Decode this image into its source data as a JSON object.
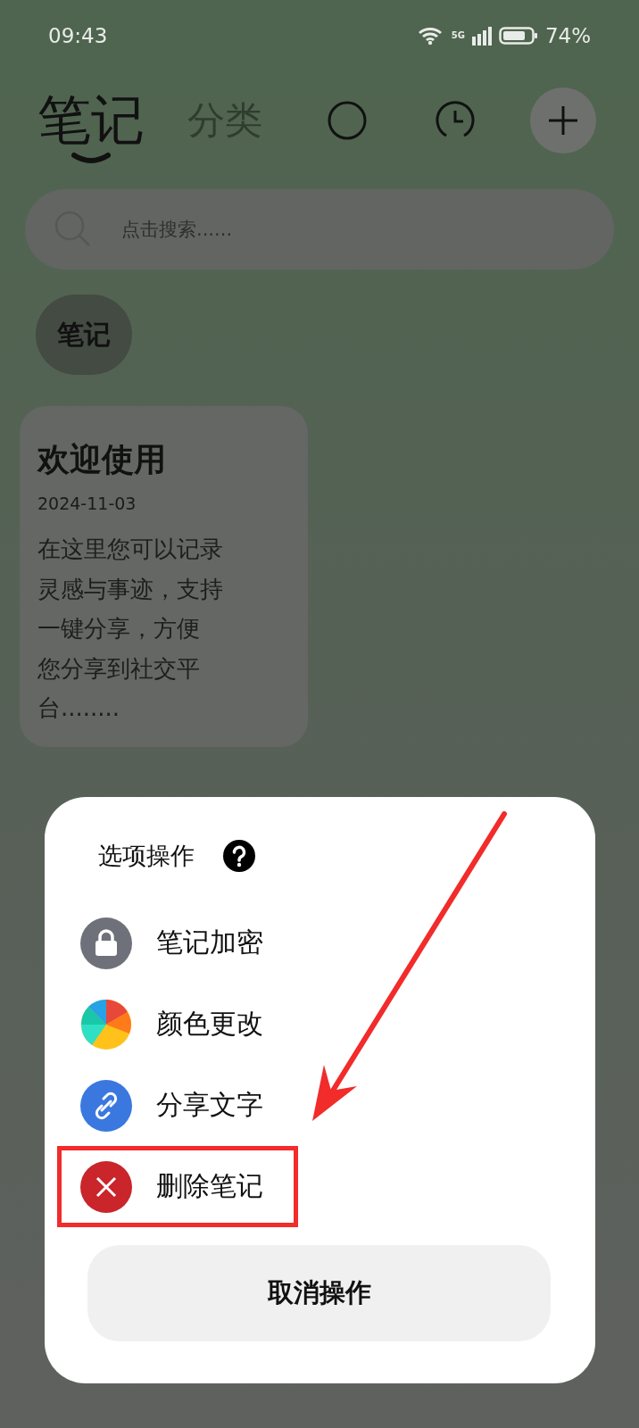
{
  "status_bar": {
    "time": "09:43",
    "network": "5G",
    "battery": "74%"
  },
  "tabs": [
    {
      "label": "笔记",
      "selected": true
    },
    {
      "label": "分类",
      "selected": false
    }
  ],
  "toolbar": [
    {
      "kind": "circle"
    },
    {
      "kind": "clock"
    },
    {
      "kind": "add"
    }
  ],
  "search": {
    "placeholder": "点击搜索......"
  },
  "filters": [
    {
      "label": "笔记",
      "selected": true
    }
  ],
  "notes": [
    {
      "title": "欢迎使用",
      "date": "2024-11-03",
      "preview_lines": [
        "在这里您可以记录",
        "灵感与事迹，支持",
        "一键分享，方便",
        "您分享到社交平",
        "台........"
      ]
    }
  ],
  "dialog": {
    "title": "选项操作",
    "items": [
      {
        "kind": "lock",
        "label": "笔记加密",
        "highlighted": false
      },
      {
        "kind": "color",
        "label": "颜色更改",
        "highlighted": false
      },
      {
        "kind": "link",
        "label": "分享文字",
        "highlighted": false
      },
      {
        "kind": "delete",
        "label": "删除笔记",
        "highlighted": true
      }
    ],
    "cancel": "取消操作"
  }
}
